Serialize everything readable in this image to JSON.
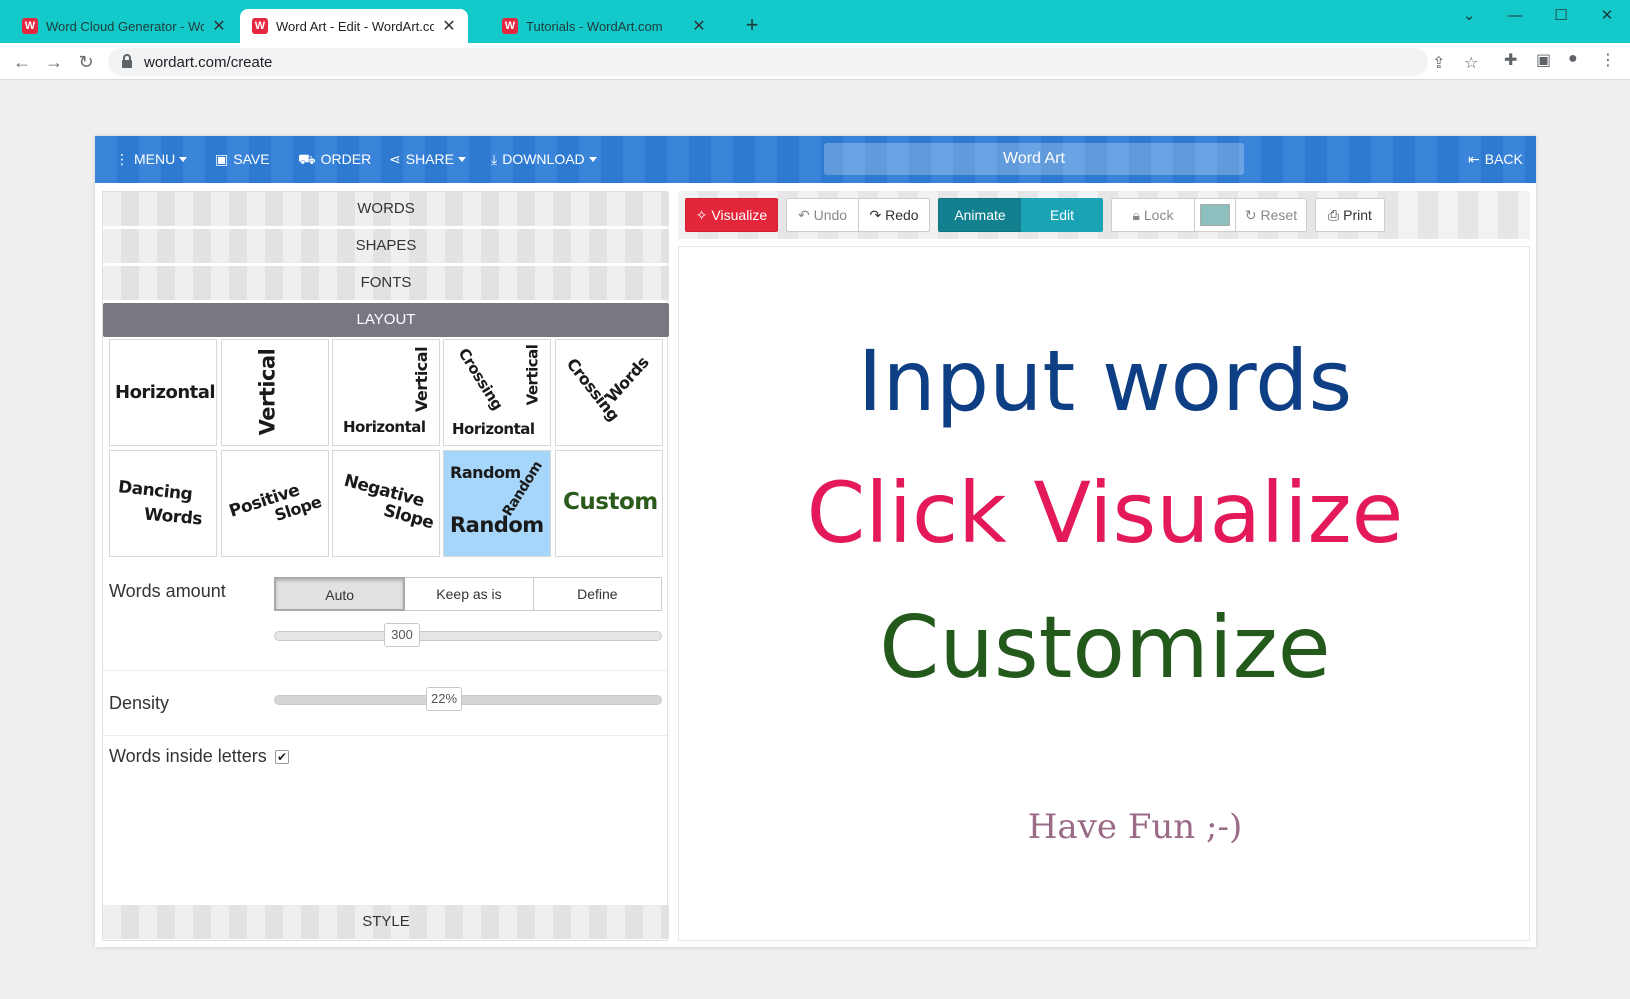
{
  "browser": {
    "tabs": [
      {
        "title": "Word Cloud Generator - WordArt.com",
        "favicon": "W"
      },
      {
        "title": "Word Art - Edit - WordArt.com",
        "favicon": "W"
      },
      {
        "title": "Tutorials - WordArt.com",
        "favicon": "W"
      }
    ],
    "url": "wordart.com/create"
  },
  "app": {
    "nav": {
      "menu": "MENU",
      "save": "SAVE",
      "order": "ORDER",
      "share": "SHARE",
      "download": "DOWNLOAD",
      "title": "Word Art",
      "back": "BACK"
    },
    "left": {
      "sections": {
        "words": "WORDS",
        "shapes": "SHAPES",
        "fonts": "FONTS",
        "layout": "LAYOUT",
        "style": "STYLE"
      },
      "layouts": [
        {
          "id": "horizontal",
          "lines": [
            "Horizontal"
          ]
        },
        {
          "id": "vertical",
          "lines": [
            "Vertical"
          ]
        },
        {
          "id": "horizontal-vertical",
          "lines": [
            "Vertical",
            "Horizontal"
          ]
        },
        {
          "id": "crossing",
          "lines": [
            "Crossing",
            "Vertical",
            "Horizontal"
          ]
        },
        {
          "id": "crossing-words",
          "lines": [
            "Crossing",
            "Words"
          ]
        },
        {
          "id": "dancing-words",
          "lines": [
            "Dancing",
            "Words"
          ]
        },
        {
          "id": "positive-slope",
          "lines": [
            "Positive",
            "Slope"
          ]
        },
        {
          "id": "negative-slope",
          "lines": [
            "Negative",
            "Slope"
          ]
        },
        {
          "id": "random",
          "lines": [
            "Random",
            "Random",
            "Random"
          ],
          "selected": true
        },
        {
          "id": "custom",
          "lines": [
            "Custom"
          ]
        }
      ],
      "words_amount": {
        "label": "Words amount",
        "options": [
          "Auto",
          "Keep as is",
          "Define"
        ],
        "selected": "Auto",
        "value": "300",
        "value_fraction": 0.31
      },
      "density": {
        "label": "Density",
        "value": "22%",
        "value_fraction": 0.43
      },
      "words_inside_letters": {
        "label": "Words inside letters",
        "checked": true,
        "check_glyph": "✔"
      }
    },
    "toolbar": {
      "visualize": "Visualize",
      "undo": "Undo",
      "redo": "Redo",
      "animate": "Animate",
      "edit": "Edit",
      "lock": "Lock",
      "reset": "Reset",
      "print": "Print",
      "swatch_color": "#8ebfbf"
    },
    "canvas": {
      "line1": "Input words",
      "line2": "Click Visualize",
      "line3": "Customize",
      "line4": "Have Fun ;-)",
      "colors": {
        "line1": "#0e3f85",
        "line2": "#e3195a",
        "line3": "#235a1c",
        "line4": "#9a6a86"
      }
    }
  },
  "colors": {
    "tabbar": "#14c9c9",
    "nav": "#2f7ed8",
    "accent_red": "#e3263a",
    "teal": "#1aa3b5",
    "layout_open": "#7a7783",
    "selected_layout": "#a6d6fa",
    "custom_text": "#2b5b1a"
  }
}
